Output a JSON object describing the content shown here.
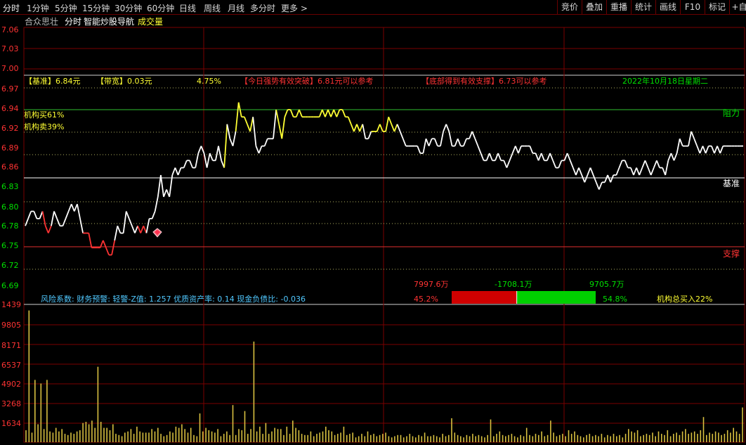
{
  "tabs": [
    {
      "label": "分时",
      "active": true
    },
    {
      "label": "1分钟"
    },
    {
      "label": "5分钟"
    },
    {
      "label": "15分钟"
    },
    {
      "label": "30分钟"
    },
    {
      "label": "60分钟"
    },
    {
      "label": "日线"
    },
    {
      "label": "周线"
    },
    {
      "label": "月线"
    },
    {
      "label": "多分时"
    },
    {
      "label": "更多 >"
    }
  ],
  "right_buttons": [
    "竞价",
    "叠加",
    "重播",
    "统计",
    "画线",
    "F10",
    "标记",
    "+自选"
  ],
  "header": {
    "app_name": "合众思壮",
    "view_name": "分时",
    "indicator_name": "智能炒股导航",
    "volume_label": "成交量"
  },
  "price_axis": [
    "7.06",
    "7.03",
    "7.00",
    "6.97",
    "6.94",
    "6.92",
    "6.89",
    "6.86",
    "6.83",
    "6.80",
    "6.78",
    "6.75",
    "6.72",
    "6.69"
  ],
  "volume_axis": [
    "1439",
    "9805",
    "8171",
    "6537",
    "4902",
    "3268",
    "1634"
  ],
  "info_bar": {
    "benchmark": "【基准】6.84元",
    "bandwidth": "【带宽】0.03元",
    "pct": "4.75%",
    "breakout": "【今日强势有效突破】6.81元可以参考",
    "support_tip": "【底部得到有效支撑】6.73可以参考",
    "date": "2022年10月18日星期二"
  },
  "inst_buy": "机构买61%",
  "inst_sell": "机构卖39%",
  "resistance_label": "阻力",
  "benchmark_label": "基准",
  "support_label": "支撑",
  "risk_text": "风险系数: 财务预警: 轻警-Z值: 1.257 优质资产率: 0.14 现金负债比: -0.036",
  "flow": {
    "buy_amount": "7997.6万",
    "net_amount": "-1708.1万",
    "sell_amount": "9705.7万",
    "buy_pct": "45.2%",
    "sell_pct": "54.8%",
    "inst_total": "机构总买入22%",
    "buy_fraction": 0.452
  },
  "colors": {
    "up": "#ff3333",
    "down": "#00e000",
    "line_white": "#ffffff",
    "line_yellow": "#ffff33",
    "grid": "#7a0000"
  },
  "price_line": [
    [
      6.78,
      "r"
    ],
    [
      6.79,
      "w"
    ],
    [
      6.8,
      "w"
    ],
    [
      6.8,
      "w"
    ],
    [
      6.79,
      "w"
    ],
    [
      6.79,
      "w"
    ],
    [
      6.8,
      "w"
    ],
    [
      6.78,
      "r"
    ],
    [
      6.77,
      "r"
    ],
    [
      6.78,
      "r"
    ],
    [
      6.8,
      "w"
    ],
    [
      6.79,
      "w"
    ],
    [
      6.78,
      "w"
    ],
    [
      6.78,
      "w"
    ],
    [
      6.79,
      "w"
    ],
    [
      6.8,
      "w"
    ],
    [
      6.81,
      "w"
    ],
    [
      6.8,
      "w"
    ],
    [
      6.81,
      "w"
    ],
    [
      6.79,
      "w"
    ],
    [
      6.77,
      "w"
    ],
    [
      6.77,
      "r"
    ],
    [
      6.77,
      "r"
    ],
    [
      6.75,
      "r"
    ],
    [
      6.75,
      "r"
    ],
    [
      6.75,
      "r"
    ],
    [
      6.75,
      "r"
    ],
    [
      6.76,
      "r"
    ],
    [
      6.75,
      "r"
    ],
    [
      6.74,
      "r"
    ],
    [
      6.74,
      "r"
    ],
    [
      6.76,
      "r"
    ],
    [
      6.78,
      "w"
    ],
    [
      6.77,
      "w"
    ],
    [
      6.77,
      "w"
    ],
    [
      6.8,
      "w"
    ],
    [
      6.79,
      "w"
    ],
    [
      6.78,
      "w"
    ],
    [
      6.77,
      "w"
    ],
    [
      6.78,
      "w"
    ],
    [
      6.77,
      "r"
    ],
    [
      6.78,
      "r"
    ],
    [
      6.77,
      "r"
    ],
    [
      6.79,
      "w"
    ],
    [
      6.79,
      "w"
    ],
    [
      6.8,
      "w"
    ],
    [
      6.82,
      "w"
    ],
    [
      6.85,
      "w"
    ],
    [
      6.82,
      "w"
    ],
    [
      6.83,
      "w"
    ],
    [
      6.82,
      "w"
    ],
    [
      6.85,
      "w"
    ],
    [
      6.86,
      "w"
    ],
    [
      6.85,
      "w"
    ],
    [
      6.86,
      "w"
    ],
    [
      6.86,
      "w"
    ],
    [
      6.87,
      "w"
    ],
    [
      6.87,
      "w"
    ],
    [
      6.86,
      "w"
    ],
    [
      6.86,
      "w"
    ],
    [
      6.88,
      "w"
    ],
    [
      6.89,
      "w"
    ],
    [
      6.88,
      "w"
    ],
    [
      6.86,
      "w"
    ],
    [
      6.88,
      "w"
    ],
    [
      6.87,
      "w"
    ],
    [
      6.87,
      "w"
    ],
    [
      6.89,
      "w"
    ],
    [
      6.87,
      "w"
    ],
    [
      6.86,
      "w"
    ],
    [
      6.92,
      "y"
    ],
    [
      6.9,
      "w"
    ],
    [
      6.89,
      "w"
    ],
    [
      6.91,
      "w"
    ],
    [
      6.95,
      "y"
    ],
    [
      6.93,
      "y"
    ],
    [
      6.93,
      "y"
    ],
    [
      6.92,
      "y"
    ],
    [
      6.91,
      "y"
    ],
    [
      6.93,
      "y"
    ],
    [
      6.89,
      "w"
    ],
    [
      6.88,
      "w"
    ],
    [
      6.89,
      "w"
    ],
    [
      6.89,
      "w"
    ],
    [
      6.9,
      "w"
    ],
    [
      6.9,
      "w"
    ],
    [
      6.9,
      "w"
    ],
    [
      6.94,
      "w"
    ],
    [
      6.92,
      "y"
    ],
    [
      6.9,
      "y"
    ],
    [
      6.93,
      "y"
    ],
    [
      6.94,
      "y"
    ],
    [
      6.94,
      "y"
    ],
    [
      6.93,
      "y"
    ],
    [
      6.93,
      "y"
    ],
    [
      6.94,
      "y"
    ],
    [
      6.93,
      "y"
    ],
    [
      6.93,
      "y"
    ],
    [
      6.93,
      "y"
    ],
    [
      6.93,
      "y"
    ],
    [
      6.93,
      "y"
    ],
    [
      6.93,
      "y"
    ],
    [
      6.93,
      "y"
    ],
    [
      6.94,
      "y"
    ],
    [
      6.93,
      "y"
    ],
    [
      6.94,
      "y"
    ],
    [
      6.93,
      "y"
    ],
    [
      6.94,
      "y"
    ],
    [
      6.93,
      "y"
    ],
    [
      6.94,
      "y"
    ],
    [
      6.94,
      "y"
    ],
    [
      6.93,
      "y"
    ],
    [
      6.93,
      "y"
    ],
    [
      6.92,
      "y"
    ],
    [
      6.91,
      "y"
    ],
    [
      6.92,
      "y"
    ],
    [
      6.91,
      "y"
    ],
    [
      6.92,
      "y"
    ],
    [
      6.9,
      "w"
    ],
    [
      6.9,
      "w"
    ],
    [
      6.91,
      "w"
    ],
    [
      6.91,
      "y"
    ],
    [
      6.91,
      "y"
    ],
    [
      6.92,
      "y"
    ],
    [
      6.91,
      "y"
    ],
    [
      6.91,
      "y"
    ],
    [
      6.93,
      "y"
    ],
    [
      6.92,
      "y"
    ],
    [
      6.91,
      "y"
    ],
    [
      6.92,
      "y"
    ],
    [
      6.91,
      "w"
    ],
    [
      6.9,
      "w"
    ],
    [
      6.89,
      "w"
    ],
    [
      6.89,
      "w"
    ],
    [
      6.89,
      "w"
    ],
    [
      6.89,
      "w"
    ],
    [
      6.89,
      "w"
    ],
    [
      6.88,
      "w"
    ],
    [
      6.88,
      "w"
    ],
    [
      6.9,
      "w"
    ],
    [
      6.89,
      "w"
    ],
    [
      6.9,
      "w"
    ],
    [
      6.9,
      "w"
    ],
    [
      6.89,
      "w"
    ],
    [
      6.89,
      "w"
    ],
    [
      6.91,
      "w"
    ],
    [
      6.92,
      "w"
    ],
    [
      6.91,
      "w"
    ],
    [
      6.89,
      "w"
    ],
    [
      6.89,
      "w"
    ],
    [
      6.9,
      "w"
    ],
    [
      6.89,
      "w"
    ],
    [
      6.89,
      "w"
    ],
    [
      6.9,
      "w"
    ],
    [
      6.9,
      "w"
    ],
    [
      6.91,
      "w"
    ],
    [
      6.9,
      "w"
    ],
    [
      6.89,
      "w"
    ],
    [
      6.88,
      "w"
    ],
    [
      6.87,
      "w"
    ],
    [
      6.87,
      "w"
    ],
    [
      6.88,
      "w"
    ],
    [
      6.87,
      "w"
    ],
    [
      6.87,
      "w"
    ],
    [
      6.88,
      "w"
    ],
    [
      6.87,
      "w"
    ],
    [
      6.87,
      "w"
    ],
    [
      6.86,
      "w"
    ],
    [
      6.87,
      "w"
    ],
    [
      6.88,
      "w"
    ],
    [
      6.89,
      "w"
    ],
    [
      6.88,
      "w"
    ],
    [
      6.89,
      "w"
    ],
    [
      6.89,
      "w"
    ],
    [
      6.89,
      "w"
    ],
    [
      6.89,
      "w"
    ],
    [
      6.88,
      "w"
    ],
    [
      6.88,
      "w"
    ],
    [
      6.87,
      "w"
    ],
    [
      6.88,
      "w"
    ],
    [
      6.87,
      "w"
    ],
    [
      6.87,
      "w"
    ],
    [
      6.88,
      "w"
    ],
    [
      6.87,
      "w"
    ],
    [
      6.86,
      "w"
    ],
    [
      6.86,
      "w"
    ],
    [
      6.87,
      "w"
    ],
    [
      6.87,
      "w"
    ],
    [
      6.88,
      "w"
    ],
    [
      6.87,
      "w"
    ],
    [
      6.86,
      "w"
    ],
    [
      6.85,
      "w"
    ],
    [
      6.86,
      "w"
    ],
    [
      6.85,
      "w"
    ],
    [
      6.84,
      "w"
    ],
    [
      6.85,
      "w"
    ],
    [
      6.86,
      "w"
    ],
    [
      6.85,
      "w"
    ],
    [
      6.84,
      "w"
    ],
    [
      6.83,
      "w"
    ],
    [
      6.84,
      "w"
    ],
    [
      6.84,
      "w"
    ],
    [
      6.85,
      "w"
    ],
    [
      6.84,
      "w"
    ],
    [
      6.85,
      "w"
    ],
    [
      6.85,
      "w"
    ],
    [
      6.86,
      "w"
    ],
    [
      6.87,
      "w"
    ],
    [
      6.87,
      "w"
    ],
    [
      6.86,
      "w"
    ],
    [
      6.86,
      "w"
    ],
    [
      6.85,
      "w"
    ],
    [
      6.86,
      "w"
    ],
    [
      6.85,
      "w"
    ],
    [
      6.86,
      "w"
    ],
    [
      6.87,
      "w"
    ],
    [
      6.86,
      "w"
    ],
    [
      6.85,
      "w"
    ],
    [
      6.86,
      "w"
    ],
    [
      6.87,
      "w"
    ],
    [
      6.86,
      "w"
    ],
    [
      6.86,
      "w"
    ],
    [
      6.85,
      "w"
    ],
    [
      6.87,
      "w"
    ],
    [
      6.88,
      "w"
    ],
    [
      6.87,
      "w"
    ],
    [
      6.88,
      "w"
    ],
    [
      6.9,
      "w"
    ],
    [
      6.89,
      "w"
    ],
    [
      6.89,
      "w"
    ],
    [
      6.89,
      "w"
    ],
    [
      6.91,
      "w"
    ],
    [
      6.9,
      "w"
    ],
    [
      6.89,
      "w"
    ],
    [
      6.88,
      "w"
    ],
    [
      6.89,
      "w"
    ],
    [
      6.88,
      "w"
    ],
    [
      6.89,
      "w"
    ],
    [
      6.89,
      "w"
    ],
    [
      6.88,
      "w"
    ],
    [
      6.89,
      "w"
    ],
    [
      6.88,
      "w"
    ],
    [
      6.89,
      "w"
    ],
    [
      6.89,
      "w"
    ],
    [
      6.89,
      "w"
    ],
    [
      6.89,
      "w"
    ],
    [
      6.89,
      "w"
    ],
    [
      6.89,
      "w"
    ],
    [
      6.89,
      "w"
    ],
    [
      6.89,
      "w"
    ]
  ],
  "volume_bars": [
    1000,
    11000,
    800,
    5200,
    1500,
    4900,
    1100,
    5200,
    900,
    800,
    1200,
    900,
    1100,
    700,
    600,
    800,
    700,
    900,
    1000,
    1600,
    1700,
    1500,
    1800,
    1200,
    6300,
    1700,
    1200,
    1200,
    1000,
    1500,
    700,
    600,
    500,
    800,
    900,
    1100,
    700,
    1300,
    900,
    800,
    800,
    800,
    1100,
    900,
    1200,
    700,
    500,
    600,
    900,
    800,
    1300,
    1200,
    1500,
    1100,
    800,
    1200,
    600,
    500,
    2400,
    900,
    1200,
    1000,
    900,
    800,
    1100,
    500,
    700,
    900,
    600,
    3100,
    600,
    1100,
    1000,
    2600,
    700,
    1100,
    8400,
    900,
    1300,
    700,
    1600,
    700,
    900,
    1200,
    1100,
    1100,
    600,
    1300,
    700,
    1800,
    1200,
    1000,
    700,
    600,
    600,
    900,
    500,
    700,
    800,
    900,
    1300,
    1000,
    900,
    600,
    700,
    800,
    1300,
    600,
    700,
    800,
    400,
    500,
    700,
    500,
    900,
    600,
    700,
    500,
    600,
    700,
    800,
    500,
    400,
    500,
    600,
    600,
    400,
    500,
    700,
    500,
    400,
    600,
    500,
    800,
    500,
    500,
    600,
    500,
    400,
    700,
    500,
    600,
    2000,
    800,
    600,
    500,
    400,
    600,
    500,
    700,
    500,
    600,
    500,
    400,
    600,
    1900,
    500,
    700,
    900,
    600,
    500,
    600,
    700,
    500,
    400,
    600,
    500,
    1200,
    600,
    500,
    700,
    600,
    900,
    500,
    600,
    1800,
    800,
    500,
    600,
    700,
    500,
    1000,
    700,
    900,
    600,
    500,
    400,
    600,
    700,
    500,
    600,
    500,
    700,
    400,
    600,
    500,
    700,
    500,
    600,
    400,
    700,
    1100,
    900,
    800,
    1000,
    500,
    600,
    700,
    600,
    800,
    500,
    900,
    700,
    600,
    1000,
    500,
    700,
    800,
    600,
    900,
    1100,
    700,
    800,
    900,
    700,
    1000,
    2100,
    600,
    800,
    700,
    900,
    800,
    600,
    700,
    1000,
    800,
    1200,
    900,
    700,
    2900
  ]
}
